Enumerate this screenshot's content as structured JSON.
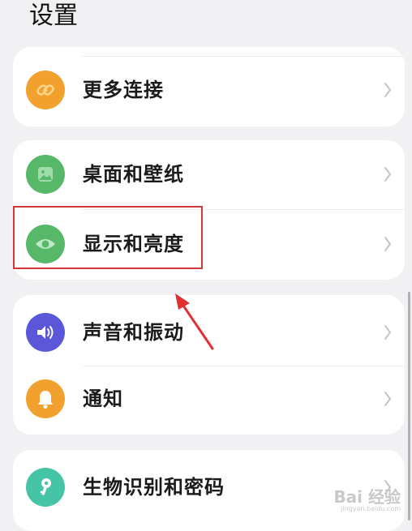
{
  "header": {
    "title": "设置"
  },
  "groups": [
    {
      "items": [
        {
          "label": "更多连接",
          "icon": "link-icon",
          "icon_color": "#f2a12e"
        }
      ]
    },
    {
      "items": [
        {
          "label": "桌面和壁纸",
          "icon": "wallpaper-icon",
          "icon_color": "#58b86a"
        },
        {
          "label": "显示和亮度",
          "icon": "eye-icon",
          "icon_color": "#58b86a"
        }
      ]
    },
    {
      "items": [
        {
          "label": "声音和振动",
          "icon": "speaker-icon",
          "icon_color": "#5b57d8"
        },
        {
          "label": "通知",
          "icon": "bell-icon",
          "icon_color": "#f2a12e"
        }
      ]
    },
    {
      "items": [
        {
          "label": "生物识别和密码",
          "icon": "key-icon",
          "icon_color": "#45c4a6"
        }
      ]
    }
  ],
  "annotation": {
    "highlight_color": "#d23a3a",
    "highlighted_item": "显示和亮度"
  },
  "watermark": {
    "text": "Bai 经验",
    "url": "jingyan.baidu.com"
  }
}
